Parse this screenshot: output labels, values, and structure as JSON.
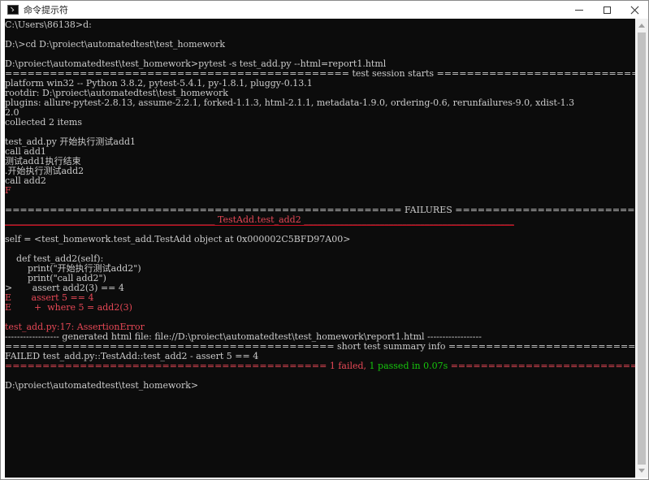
{
  "window": {
    "title": "命令提示符",
    "buttons": {
      "minimize": "minimize",
      "maximize": "maximize",
      "close": "close"
    }
  },
  "console": {
    "lines": [
      "C:\\Users\\86138>d:",
      "",
      "D:\\>cd D:\\proiect\\automatedtest\\test_homework",
      "",
      "D:\\proiect\\automatedtest\\test_homework>pytest -s test_add.py --html=report1.html",
      "============================================== test session starts ==============================================",
      "platform win32 -- Python 3.8.2, pytest-5.4.1, py-1.8.1, pluggy-0.13.1",
      "rootdir: D:\\proiect\\automatedtest\\test_homework",
      "plugins: allure-pytest-2.8.13, assume-2.2.1, forked-1.1.3, html-2.1.1, metadata-1.9.0, ordering-0.6, rerunfailures-9.0, xdist-1.3",
      "2.0",
      "collected 2 items",
      "",
      "test_add.py 开始执行测试add1",
      "call add1",
      "测试add1执行结束",
      ".开始执行测试add2",
      "call add2",
      "F",
      "",
      "===================================================== FAILURES ======================================================",
      "_______________________________________________ TestAdd.test_add2 _______________________________________________",
      "",
      "self = <test_homework.test_add.TestAdd object at 0x000002C5BFD97A00>",
      "",
      "    def test_add2(self):",
      "        print(\"开始执行测试add2\")",
      "        print(\"call add2\")",
      ">       assert add2(3) == 4",
      "E       assert 5 == 4",
      "E        +  where 5 = add2(3)",
      "",
      "test_add.py:17: AssertionError",
      "------------------ generated html file: file://D:\\proiect\\automatedtest\\test_homework\\report1.html ------------------",
      "============================================ short test summary info ============================================",
      "FAILED test_add.py::TestAdd::test_add2 - assert 5 == 4",
      "========================================= 1 failed, 1 passed in 0.07s =========================================",
      "",
      "D:\\proiect\\automatedtest\\test_homework>"
    ],
    "summary_failed": "1 failed",
    "summary_sep": ", ",
    "summary_passed": "1 passed in 0.07s",
    "summary_left": "=========================================== ",
    "summary_right": " ============================================"
  },
  "colors": {
    "background": "#0c0c0c",
    "text": "#cccccc",
    "error": "#e74856",
    "pass": "#16c60c"
  }
}
